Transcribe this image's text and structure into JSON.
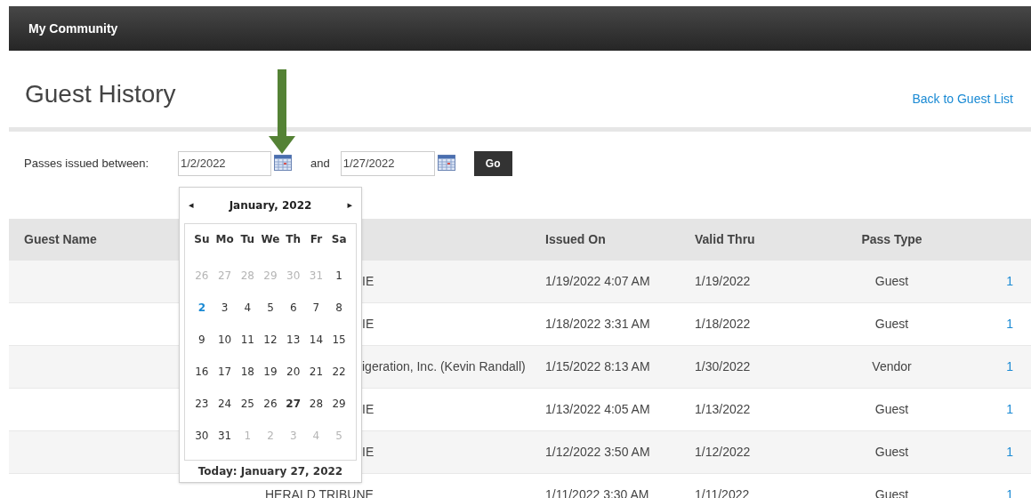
{
  "top_bar": {
    "title": "My Community"
  },
  "header": {
    "title": "Guest History",
    "back_link": "Back to Guest List"
  },
  "filter": {
    "label": "Passes issued between:",
    "start": "1/2/2022",
    "joiner": "and",
    "end": "1/27/2022",
    "go": "Go"
  },
  "table": {
    "headers": {
      "guest_name": "Guest Name",
      "issued_on": "Issued On",
      "valid_thru": "Valid Thru",
      "pass_type": "Pass Type"
    },
    "rows": [
      {
        "column_2": "IE",
        "covered": true,
        "issued_on": "1/19/2022 4:07 AM",
        "valid_thru": "1/19/2022",
        "pass_type": "Guest",
        "column_6": "1"
      },
      {
        "column_2": "IE",
        "covered": true,
        "issued_on": "1/18/2022 3:31 AM",
        "valid_thru": "1/18/2022",
        "pass_type": "Guest",
        "column_6": "1"
      },
      {
        "column_2": "igeration, Inc. (Kevin Randall)",
        "covered": true,
        "issued_on": "1/15/2022 8:13 AM",
        "valid_thru": "1/30/2022",
        "pass_type": "Vendor",
        "column_6": "1"
      },
      {
        "column_2": "IE",
        "covered": true,
        "issued_on": "1/13/2022 4:05 AM",
        "valid_thru": "1/13/2022",
        "pass_type": "Guest",
        "column_6": "1"
      },
      {
        "column_2": "IE",
        "covered": true,
        "issued_on": "1/12/2022 3:50 AM",
        "valid_thru": "1/12/2022",
        "pass_type": "Guest",
        "column_6": "1"
      },
      {
        "column_2": "HERALD TRIBUNE",
        "issued_on": "1/11/2022 3:30 AM",
        "valid_thru": "1/11/2022",
        "pass_type": "Guest",
        "column_6": "1"
      }
    ]
  },
  "calendar": {
    "prev": "◂",
    "month": "January, 2022",
    "next": "▸",
    "weekdays": [
      "Su",
      "Mo",
      "Tu",
      "We",
      "Th",
      "Fr",
      "Sa"
    ],
    "days": [
      {
        "day": "26",
        "muted": true,
        "selected": false,
        "today": false
      },
      {
        "day": "27",
        "muted": true,
        "selected": false,
        "today": false
      },
      {
        "day": "28",
        "muted": true,
        "selected": false,
        "today": false
      },
      {
        "day": "29",
        "muted": true,
        "selected": false,
        "today": false
      },
      {
        "day": "30",
        "muted": true,
        "selected": false,
        "today": false
      },
      {
        "day": "31",
        "muted": true,
        "selected": false,
        "today": false
      },
      {
        "day": "1",
        "muted": false,
        "selected": false,
        "today": false
      },
      {
        "day": "2",
        "muted": false,
        "selected": true,
        "today": false
      },
      {
        "day": "3",
        "muted": false,
        "selected": false,
        "today": false
      },
      {
        "day": "4",
        "muted": false,
        "selected": false,
        "today": false
      },
      {
        "day": "5",
        "muted": false,
        "selected": false,
        "today": false
      },
      {
        "day": "6",
        "muted": false,
        "selected": false,
        "today": false
      },
      {
        "day": "7",
        "muted": false,
        "selected": false,
        "today": false
      },
      {
        "day": "8",
        "muted": false,
        "selected": false,
        "today": false
      },
      {
        "day": "9",
        "muted": false,
        "selected": false,
        "today": false
      },
      {
        "day": "10",
        "muted": false,
        "selected": false,
        "today": false
      },
      {
        "day": "11",
        "muted": false,
        "selected": false,
        "today": false
      },
      {
        "day": "12",
        "muted": false,
        "selected": false,
        "today": false
      },
      {
        "day": "13",
        "muted": false,
        "selected": false,
        "today": false
      },
      {
        "day": "14",
        "muted": false,
        "selected": false,
        "today": false
      },
      {
        "day": "15",
        "muted": false,
        "selected": false,
        "today": false
      },
      {
        "day": "16",
        "muted": false,
        "selected": false,
        "today": false
      },
      {
        "day": "17",
        "muted": false,
        "selected": false,
        "today": false
      },
      {
        "day": "18",
        "muted": false,
        "selected": false,
        "today": false
      },
      {
        "day": "19",
        "muted": false,
        "selected": false,
        "today": false
      },
      {
        "day": "20",
        "muted": false,
        "selected": false,
        "today": false
      },
      {
        "day": "21",
        "muted": false,
        "selected": false,
        "today": false
      },
      {
        "day": "22",
        "muted": false,
        "selected": false,
        "today": false
      },
      {
        "day": "23",
        "muted": false,
        "selected": false,
        "today": false
      },
      {
        "day": "24",
        "muted": false,
        "selected": false,
        "today": false
      },
      {
        "day": "25",
        "muted": false,
        "selected": false,
        "today": false
      },
      {
        "day": "26",
        "muted": false,
        "selected": false,
        "today": false
      },
      {
        "day": "27",
        "muted": false,
        "selected": false,
        "today": true
      },
      {
        "day": "28",
        "muted": false,
        "selected": false,
        "today": false
      },
      {
        "day": "29",
        "muted": false,
        "selected": false,
        "today": false
      },
      {
        "day": "30",
        "muted": false,
        "selected": false,
        "today": false
      },
      {
        "day": "31",
        "muted": false,
        "selected": false,
        "today": false
      },
      {
        "day": "1",
        "muted": true,
        "selected": false,
        "today": false
      },
      {
        "day": "2",
        "muted": true,
        "selected": false,
        "today": false
      },
      {
        "day": "3",
        "muted": true,
        "selected": false,
        "today": false
      },
      {
        "day": "4",
        "muted": true,
        "selected": false,
        "today": false
      },
      {
        "day": "5",
        "muted": true,
        "selected": false,
        "today": false
      }
    ],
    "footer": "Today: January 27, 2022"
  }
}
